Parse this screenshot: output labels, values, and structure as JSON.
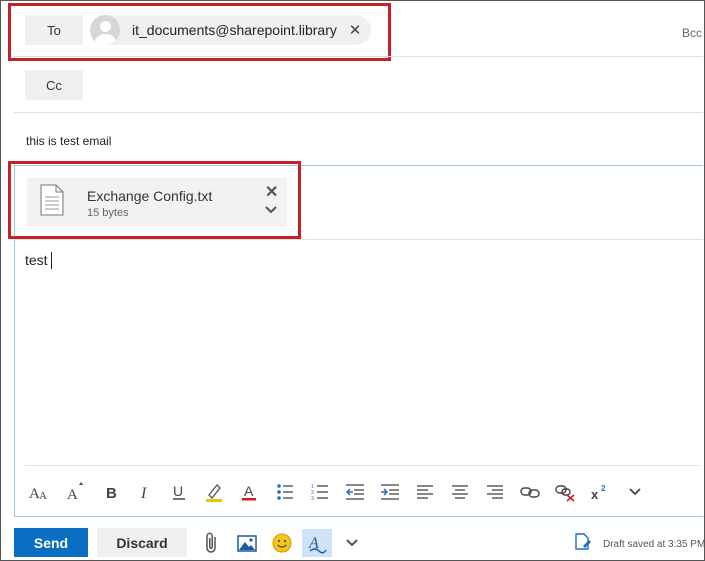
{
  "recipients": {
    "to_label": "To",
    "cc_label": "Cc",
    "bcc_label": "Bcc",
    "to_chip": {
      "address": "it_documents@sharepoint.library",
      "remove_icon": "close-icon"
    }
  },
  "subject": "this is test email",
  "attachment": {
    "name": "Exchange Config.txt",
    "size": "15 bytes",
    "icon": "file-icon"
  },
  "body": {
    "text": "test"
  },
  "toolbar": {
    "items": [
      {
        "name": "font-icon"
      },
      {
        "name": "font-size-icon"
      },
      {
        "name": "bold-icon"
      },
      {
        "name": "italic-icon"
      },
      {
        "name": "underline-icon"
      },
      {
        "name": "highlight-icon",
        "color": "#f2c200"
      },
      {
        "name": "font-color-icon",
        "color": "#d01c1c"
      },
      {
        "name": "bullets-icon"
      },
      {
        "name": "numbering-icon"
      },
      {
        "name": "decrease-indent-icon",
        "color": "#1c6fc0"
      },
      {
        "name": "increase-indent-icon",
        "color": "#1c6fc0"
      },
      {
        "name": "align-left-icon"
      },
      {
        "name": "align-center-icon"
      },
      {
        "name": "align-right-icon"
      },
      {
        "name": "insert-link-icon"
      },
      {
        "name": "remove-link-icon",
        "color": "#d01c1c"
      },
      {
        "name": "superscript-icon"
      },
      {
        "name": "more-options-icon"
      }
    ]
  },
  "actions": {
    "send_label": "Send",
    "discard_label": "Discard",
    "icons": [
      "attach-icon",
      "insert-picture-icon",
      "emoji-icon",
      "editor-icon",
      "more-chevron-icon"
    ]
  },
  "status": {
    "draft_text": "Draft saved at 3:35 PM"
  },
  "colors": {
    "accent": "#0a6fc2",
    "highlight_box": "#c8202a",
    "body_border": "#9cc8e8"
  }
}
